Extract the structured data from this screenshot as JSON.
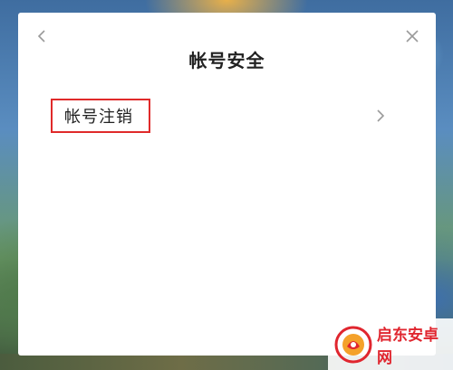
{
  "dialog": {
    "title": "帐号安全",
    "menu": [
      {
        "label": "帐号注销",
        "highlighted": true
      }
    ]
  },
  "icons": {
    "back": "chevron-left-icon",
    "close": "close-icon",
    "item_arrow": "chevron-right-icon"
  },
  "watermark": {
    "text": "启东安卓网"
  },
  "colors": {
    "highlight_border": "#e02a2a",
    "watermark_text": "#e0262f",
    "dialog_bg": "#ffffff"
  }
}
